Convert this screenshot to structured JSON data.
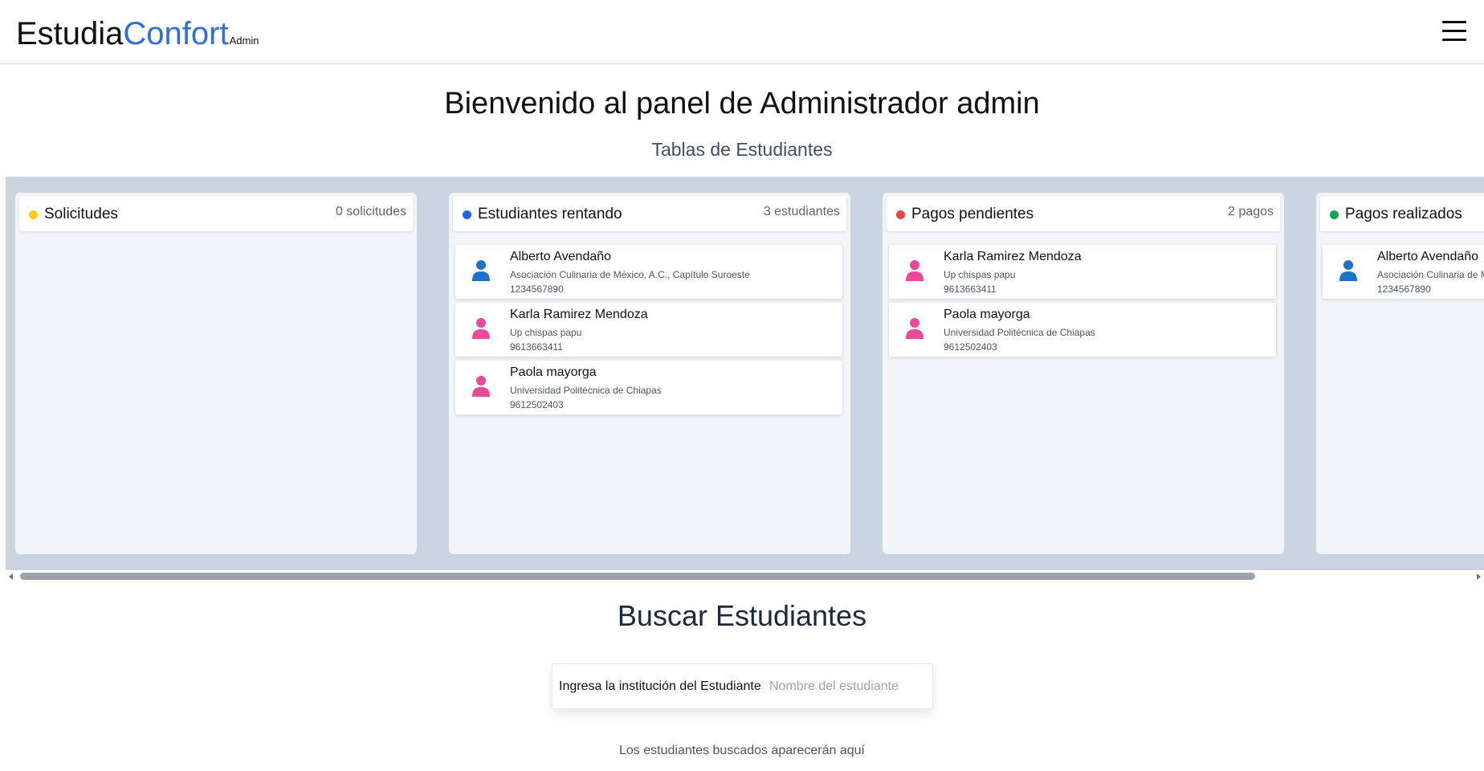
{
  "navbar": {
    "brand_part1": "Estudia",
    "brand_part2": "Confort",
    "brand_tag": "Admin",
    "accent_color": "#2f6fdc",
    "menu_icon": "hamburger-menu-icon"
  },
  "main": {
    "welcome": "Bienvenido al panel de Administrador admin",
    "subtitle": "Tablas de Estudiantes"
  },
  "board": {
    "columns": [
      {
        "title": "Solicitudes",
        "count": "0 solicitudes",
        "dot_color": "#facc15",
        "cards": []
      },
      {
        "title": "Estudiantes rentando",
        "count": "3 estudiantes",
        "dot_color": "#2563eb",
        "cards": [
          {
            "name": "Alberto Avendaño",
            "institution": "Asociación Culinaria de México, A.C., Capítulo Suroeste",
            "phone": "1234567890",
            "avatar_color": "#1d72c8"
          },
          {
            "name": "Karla Ramirez Mendoza",
            "institution": "Up chispas papu",
            "phone": "9613663411",
            "avatar_color": "#ec4899"
          },
          {
            "name": "Paola mayorga",
            "institution": "Universidad Politécnica de Chiapas",
            "phone": "9612502403",
            "avatar_color": "#ec4899"
          }
        ]
      },
      {
        "title": "Pagos pendientes",
        "count": "2 pagos",
        "dot_color": "#ef4444",
        "cards": [
          {
            "name": "Karla Ramirez Mendoza",
            "institution": "Up chispas papu",
            "phone": "9613663411",
            "avatar_color": "#ec4899"
          },
          {
            "name": "Paola mayorga",
            "institution": "Universidad Politécnica de Chiapas",
            "phone": "9612502403",
            "avatar_color": "#ec4899"
          }
        ]
      },
      {
        "title": "Pagos realizados",
        "count": "",
        "dot_color": "#16a34a",
        "cards": [
          {
            "name": "Alberto Avendaño",
            "institution": "Asociación Culinaria de México, A.C., Capítulo Suroeste",
            "phone": "1234567890",
            "avatar_color": "#1d72c8"
          }
        ]
      }
    ]
  },
  "search": {
    "title": "Buscar Estudiantes",
    "label": "Ingresa la institución del Estudiante",
    "placeholder": "Nombre del estudiante",
    "hint": "Los estudiantes buscados aparecerán aquí"
  }
}
